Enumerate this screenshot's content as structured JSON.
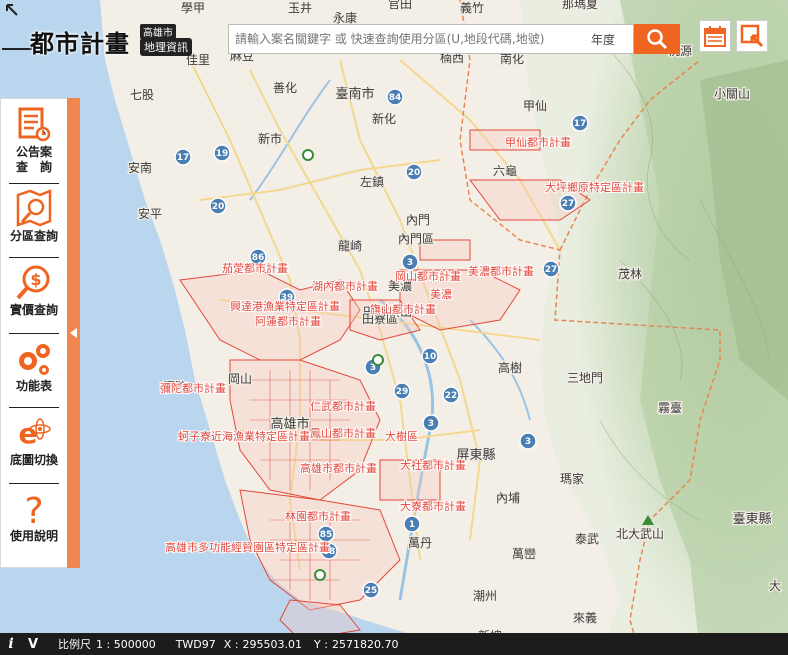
{
  "header": {
    "logo_title": "都市計畫",
    "logo_sub_top": "高雄市",
    "logo_sub_bottom": "地理資訊"
  },
  "search": {
    "placeholder": "請輸入案名關鍵字 或 快速查詢使用分區(U,地段代碼,地號)",
    "year_label": "年度"
  },
  "sidebar": {
    "items": [
      {
        "label_line1": "公告案",
        "label_line2": "查　詢",
        "icon": "bulletin-search-icon"
      },
      {
        "label_line1": "分區查詢",
        "icon": "zone-search-icon"
      },
      {
        "label_line1": "實價查詢",
        "icon": "price-search-icon"
      },
      {
        "label_line1": "功能表",
        "icon": "gears-icon"
      },
      {
        "label_line1": "底圖切換",
        "icon": "basemap-switch-icon"
      },
      {
        "label_line1": "使用說明",
        "icon": "help-icon"
      }
    ]
  },
  "status": {
    "info_icon": "i",
    "v_icon": "V",
    "scale_label": "比例尺",
    "scale_value": "1 : 500000",
    "datum": "TWD97",
    "x_label": "X :",
    "x_value": "295503.01",
    "y_label": "Y :",
    "y_value": "2571820.70"
  },
  "map": {
    "places": [
      "學甲",
      "麻豆",
      "官田",
      "佳里",
      "善化",
      "臺南市",
      "永康",
      "新市",
      "新化",
      "安定",
      "七股",
      "安南",
      "安平",
      "左鎮",
      "龍崎",
      "內門",
      "田寮",
      "旗山",
      "美濃",
      "高樹",
      "三地門",
      "霧臺",
      "屏東縣",
      "內埔",
      "瑪家",
      "泰武",
      "萬丹",
      "萬巒",
      "潮州",
      "新埤",
      "來義",
      "臺東縣",
      "北大武山",
      "高雄市",
      "南化",
      "甲仙",
      "楠西",
      "玉井",
      "六龜",
      "茂林",
      "那瑪夏",
      "桃源",
      "小關山",
      "義竹",
      "大",
      "內門區",
      "田寮區",
      "彌陀",
      "岡山"
    ],
    "plans": [
      "甲仙都市計畫",
      "大坪鄉原特定區計畫",
      "茄萣都市計畫",
      "湖內都市計畫",
      "興達港漁業特定區計畫",
      "岡山都市計畫",
      "阿蓮都市計畫",
      "美濃都市計畫",
      "美濃",
      "旗山都市計畫",
      "彌陀都市計畫",
      "蚵子寮近海漁業特定區計畫",
      "鳳山都市計畫",
      "大樹區",
      "高雄市都市計畫",
      "高雄市多功能經貿園區特定區計畫",
      "林園都市計畫",
      "大社都市計畫",
      "大寮都市計畫",
      "仁武都市計畫"
    ],
    "roads": [
      "19",
      "17",
      "20",
      "84",
      "20",
      "3",
      "86",
      "39",
      "10",
      "3",
      "22",
      "3",
      "29",
      "27",
      "27",
      "1",
      "25",
      "88",
      "85",
      "17",
      "3"
    ]
  },
  "colors": {
    "accent": "#ef6420",
    "plan_line": "#e3473c",
    "sea": "#b9d6ee",
    "land": "#f4efe6",
    "mountain": "#c7d9b7"
  }
}
